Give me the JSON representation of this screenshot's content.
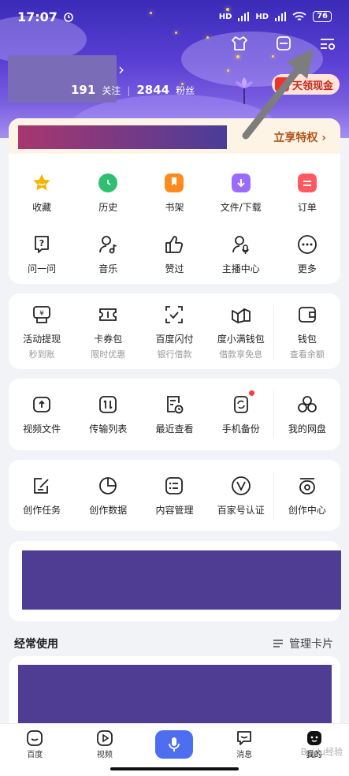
{
  "status_bar": {
    "time": "17:07",
    "signal1": "HD",
    "signal2": "HD",
    "battery": "76"
  },
  "profile": {
    "following_count": "191",
    "following_label": "关注",
    "fans_count": "2844",
    "fans_label": "粉丝",
    "cash_label": "天领现金"
  },
  "vip": {
    "privilege_label": "立享特权 ›"
  },
  "main_grid": [
    {
      "label": "收藏",
      "icon": "star-icon",
      "color": "#f7b500"
    },
    {
      "label": "历史",
      "icon": "clock-icon",
      "color": "#2fbf71"
    },
    {
      "label": "书架",
      "icon": "bookmark-icon",
      "color": "#ff8a1f"
    },
    {
      "label": "文件/下载",
      "icon": "download-folder-icon",
      "color": "#9b6bff"
    },
    {
      "label": "订单",
      "icon": "order-icon",
      "color": "#ff5a5f"
    },
    {
      "label": "问一问",
      "icon": "question-icon"
    },
    {
      "label": "音乐",
      "icon": "music-icon"
    },
    {
      "label": "赞过",
      "icon": "thumbs-up-icon"
    },
    {
      "label": "主播中心",
      "icon": "anchor-mic-icon"
    },
    {
      "label": "更多",
      "icon": "more-icon"
    }
  ],
  "finance_grid": [
    {
      "label": "活动提现",
      "sub": "秒到账",
      "icon": "withdraw-icon"
    },
    {
      "label": "卡券包",
      "sub": "限时优惠",
      "icon": "ticket-icon"
    },
    {
      "label": "百度闪付",
      "sub": "银行借款",
      "icon": "scan-pay-icon"
    },
    {
      "label": "度小满钱包",
      "sub": "借款享免息",
      "icon": "dxm-wallet-icon"
    },
    {
      "label": "钱包",
      "sub": "查看余额",
      "icon": "wallet-icon"
    }
  ],
  "disk_grid": [
    {
      "label": "视频文件",
      "icon": "video-file-icon"
    },
    {
      "label": "传输列表",
      "icon": "transfer-icon"
    },
    {
      "label": "最近查看",
      "icon": "recent-icon"
    },
    {
      "label": "手机备份",
      "icon": "backup-icon"
    },
    {
      "label": "我的网盘",
      "icon": "netdisk-icon"
    }
  ],
  "creator_grid": [
    {
      "label": "创作任务",
      "icon": "task-edit-icon"
    },
    {
      "label": "创作数据",
      "icon": "pie-chart-icon"
    },
    {
      "label": "内容管理",
      "icon": "list-manage-icon"
    },
    {
      "label": "百家号认证",
      "icon": "verify-v-icon"
    },
    {
      "label": "创作中心",
      "icon": "creator-center-icon"
    }
  ],
  "frequent": {
    "title": "经常使用",
    "manage_label": "管理卡片"
  },
  "tabbar": [
    {
      "label": "百度",
      "icon": "baidu-home-icon"
    },
    {
      "label": "视频",
      "icon": "video-play-icon"
    },
    {
      "label": "",
      "icon": "mic-icon"
    },
    {
      "label": "消息",
      "icon": "message-icon"
    },
    {
      "label": "我的",
      "icon": "profile-icon"
    }
  ],
  "watermark": "Baidu经验"
}
